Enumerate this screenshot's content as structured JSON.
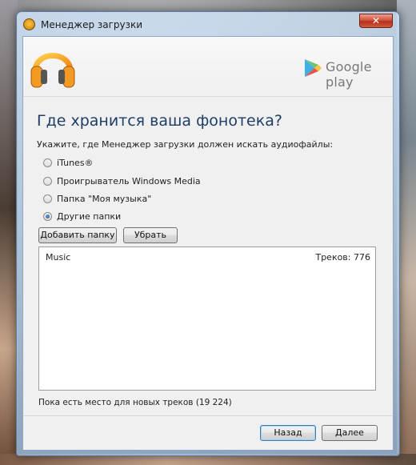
{
  "window": {
    "title": "Менеджер загрузки",
    "close_label": "✕"
  },
  "brand": {
    "logo_text": "Google play",
    "app_icon": "headphones-icon",
    "store_icon": "google-play-icon"
  },
  "page": {
    "heading": "Где хранится ваша фонотека?",
    "subtitle": "Укажите, где Менеджер загрузки должен искать аудиофайлы:"
  },
  "options": [
    {
      "label": "iTunes®",
      "checked": false
    },
    {
      "label": "Проигрыватель Windows Media",
      "checked": false
    },
    {
      "label": "Папка \"Моя музыка\"",
      "checked": false
    },
    {
      "label": "Другие папки",
      "checked": true
    }
  ],
  "actions": {
    "add_folder": "Добавить папку",
    "remove": "Убрать"
  },
  "folders": [
    {
      "name": "Music",
      "count": "Треков: 776"
    }
  ],
  "status": {
    "space_note": "Пока есть место для новых треков (19 224)"
  },
  "nav": {
    "back": "Назад",
    "next": "Далее"
  },
  "colors": {
    "heading": "#1e3e66",
    "window_border": "#5b7aa0",
    "close_button": "#c4432a"
  }
}
